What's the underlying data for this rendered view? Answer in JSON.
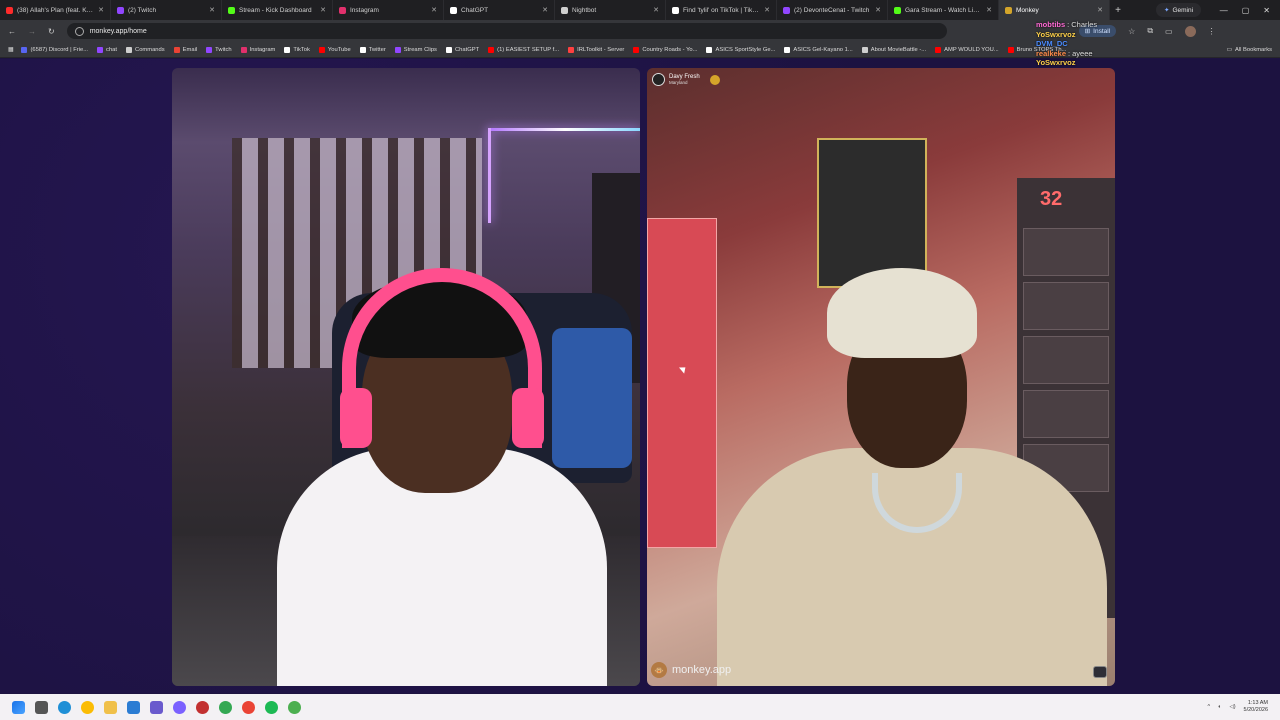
{
  "tabs": [
    {
      "title": "(38) Allah's Plan (feat. Kanye",
      "color": "#ff2b2b"
    },
    {
      "title": "(2) Twitch",
      "color": "#9146ff"
    },
    {
      "title": "Stream - Kick Dashboard",
      "color": "#53fc18"
    },
    {
      "title": "Instagram",
      "color": "#e1306c"
    },
    {
      "title": "ChatGPT",
      "color": "#ffffff"
    },
    {
      "title": "Nightbot",
      "color": "#cfcfcf"
    },
    {
      "title": "Find 'tylil' on TikTok | TikTok",
      "color": "#ffffff"
    },
    {
      "title": "(2) DevonteCenat - Twitch",
      "color": "#9146ff"
    },
    {
      "title": "Gara Stream - Watch Live on",
      "color": "#53fc18"
    },
    {
      "title": "Monkey",
      "color": "#d4a52a"
    }
  ],
  "gemini_label": "Gemini",
  "url": "monkey.app/home",
  "install_label": "Install",
  "bookmarks": [
    {
      "label": "(6587) Discord | Frie...",
      "color": "#5865f2"
    },
    {
      "label": "chat",
      "color": "#9146ff"
    },
    {
      "label": "Commands",
      "color": "#cfcfcf"
    },
    {
      "label": "Email",
      "color": "#ea4335"
    },
    {
      "label": "Twitch",
      "color": "#9146ff"
    },
    {
      "label": "Instagram",
      "color": "#e1306c"
    },
    {
      "label": "TikTok",
      "color": "#ffffff"
    },
    {
      "label": "YouTube",
      "color": "#ff0000"
    },
    {
      "label": "Twitter",
      "color": "#ffffff"
    },
    {
      "label": "Stream Clips",
      "color": "#9146ff"
    },
    {
      "label": "ChatGPT",
      "color": "#ffffff"
    },
    {
      "label": "(1) EASIEST SETUP f...",
      "color": "#ff0000"
    },
    {
      "label": "IRLToolkit - Server",
      "color": "#ff4040"
    },
    {
      "label": "Country Roads - Yo...",
      "color": "#ff0000"
    },
    {
      "label": "ASICS SportStyle Ge...",
      "color": "#ffffff"
    },
    {
      "label": "ASICS Gel-Kayano 1...",
      "color": "#ffffff"
    },
    {
      "label": "About MovieBattle -...",
      "color": "#cfcfcf"
    },
    {
      "label": "AMP WOULD YOU...",
      "color": "#ff0000"
    },
    {
      "label": "Bruno STOPS Th...",
      "color": "#ff0000"
    }
  ],
  "all_bookmarks_label": "All Bookmarks",
  "right_profile": {
    "name": "Davy Fresh",
    "location": "Maryland"
  },
  "brand_label": "monkey.app",
  "right_number": "32",
  "chat": [
    {
      "user": "mobtibs",
      "message": "Charles",
      "color": "#ff6ad5"
    },
    {
      "user": "YoSwxrvoz",
      "message": "",
      "color": "#ffd24a"
    },
    {
      "user": "DVM_DC",
      "message": "",
      "color": "#4a8bff"
    },
    {
      "user": "realkeke",
      "message": "ayeee",
      "color": "#ff8c4a"
    },
    {
      "user": "YoSwxrvoz",
      "message": "",
      "color": "#ffd24a"
    }
  ],
  "clock": {
    "time": "1:13 AM",
    "date": "5/20/2026"
  }
}
